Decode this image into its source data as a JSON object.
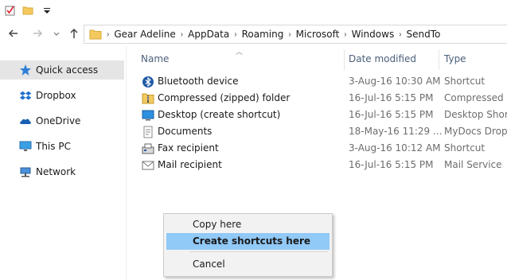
{
  "address_bar": {
    "crumbs": [
      "Gear Adeline",
      "AppData",
      "Roaming",
      "Microsoft",
      "Windows",
      "SendTo"
    ]
  },
  "sidebar": {
    "items": [
      {
        "label": "Quick access",
        "icon": "star-icon",
        "selected": true
      },
      {
        "label": "Dropbox",
        "icon": "dropbox-icon",
        "selected": false
      },
      {
        "label": "OneDrive",
        "icon": "onedrive-icon",
        "selected": false
      },
      {
        "label": "This PC",
        "icon": "computer-icon",
        "selected": false
      },
      {
        "label": "Network",
        "icon": "network-icon",
        "selected": false
      }
    ]
  },
  "columns": {
    "name": "Name",
    "date": "Date modified",
    "type": "Type"
  },
  "files": [
    {
      "name": "Bluetooth device",
      "date": "3-Aug-16 10:30 AM",
      "type": "Shortcut",
      "icon": "bluetooth-icon"
    },
    {
      "name": "Compressed (zipped) folder",
      "date": "16-Jul-16 5:15 PM",
      "type": "Compressed (z",
      "icon": "zip-folder-icon"
    },
    {
      "name": "Desktop (create shortcut)",
      "date": "16-Jul-16 5:15 PM",
      "type": "Desktop Shorto",
      "icon": "desktop-icon"
    },
    {
      "name": "Documents",
      "date": "18-May-16 11:29 ...",
      "type": "MyDocs Drop T",
      "icon": "documents-icon"
    },
    {
      "name": "Fax recipient",
      "date": "3-Aug-16 10:12 AM",
      "type": "Shortcut",
      "icon": "fax-icon"
    },
    {
      "name": "Mail recipient",
      "date": "16-Jul-16 5:15 PM",
      "type": "Mail Service",
      "icon": "mail-icon"
    }
  ],
  "context_menu": {
    "items": [
      "Copy here",
      "Create shortcuts here",
      "Cancel"
    ],
    "highlighted": "Create shortcuts here"
  },
  "colors": {
    "accent": "#91c9f7",
    "header_text": "#4c607a",
    "sidebar_selected": "#e5e5e5"
  }
}
